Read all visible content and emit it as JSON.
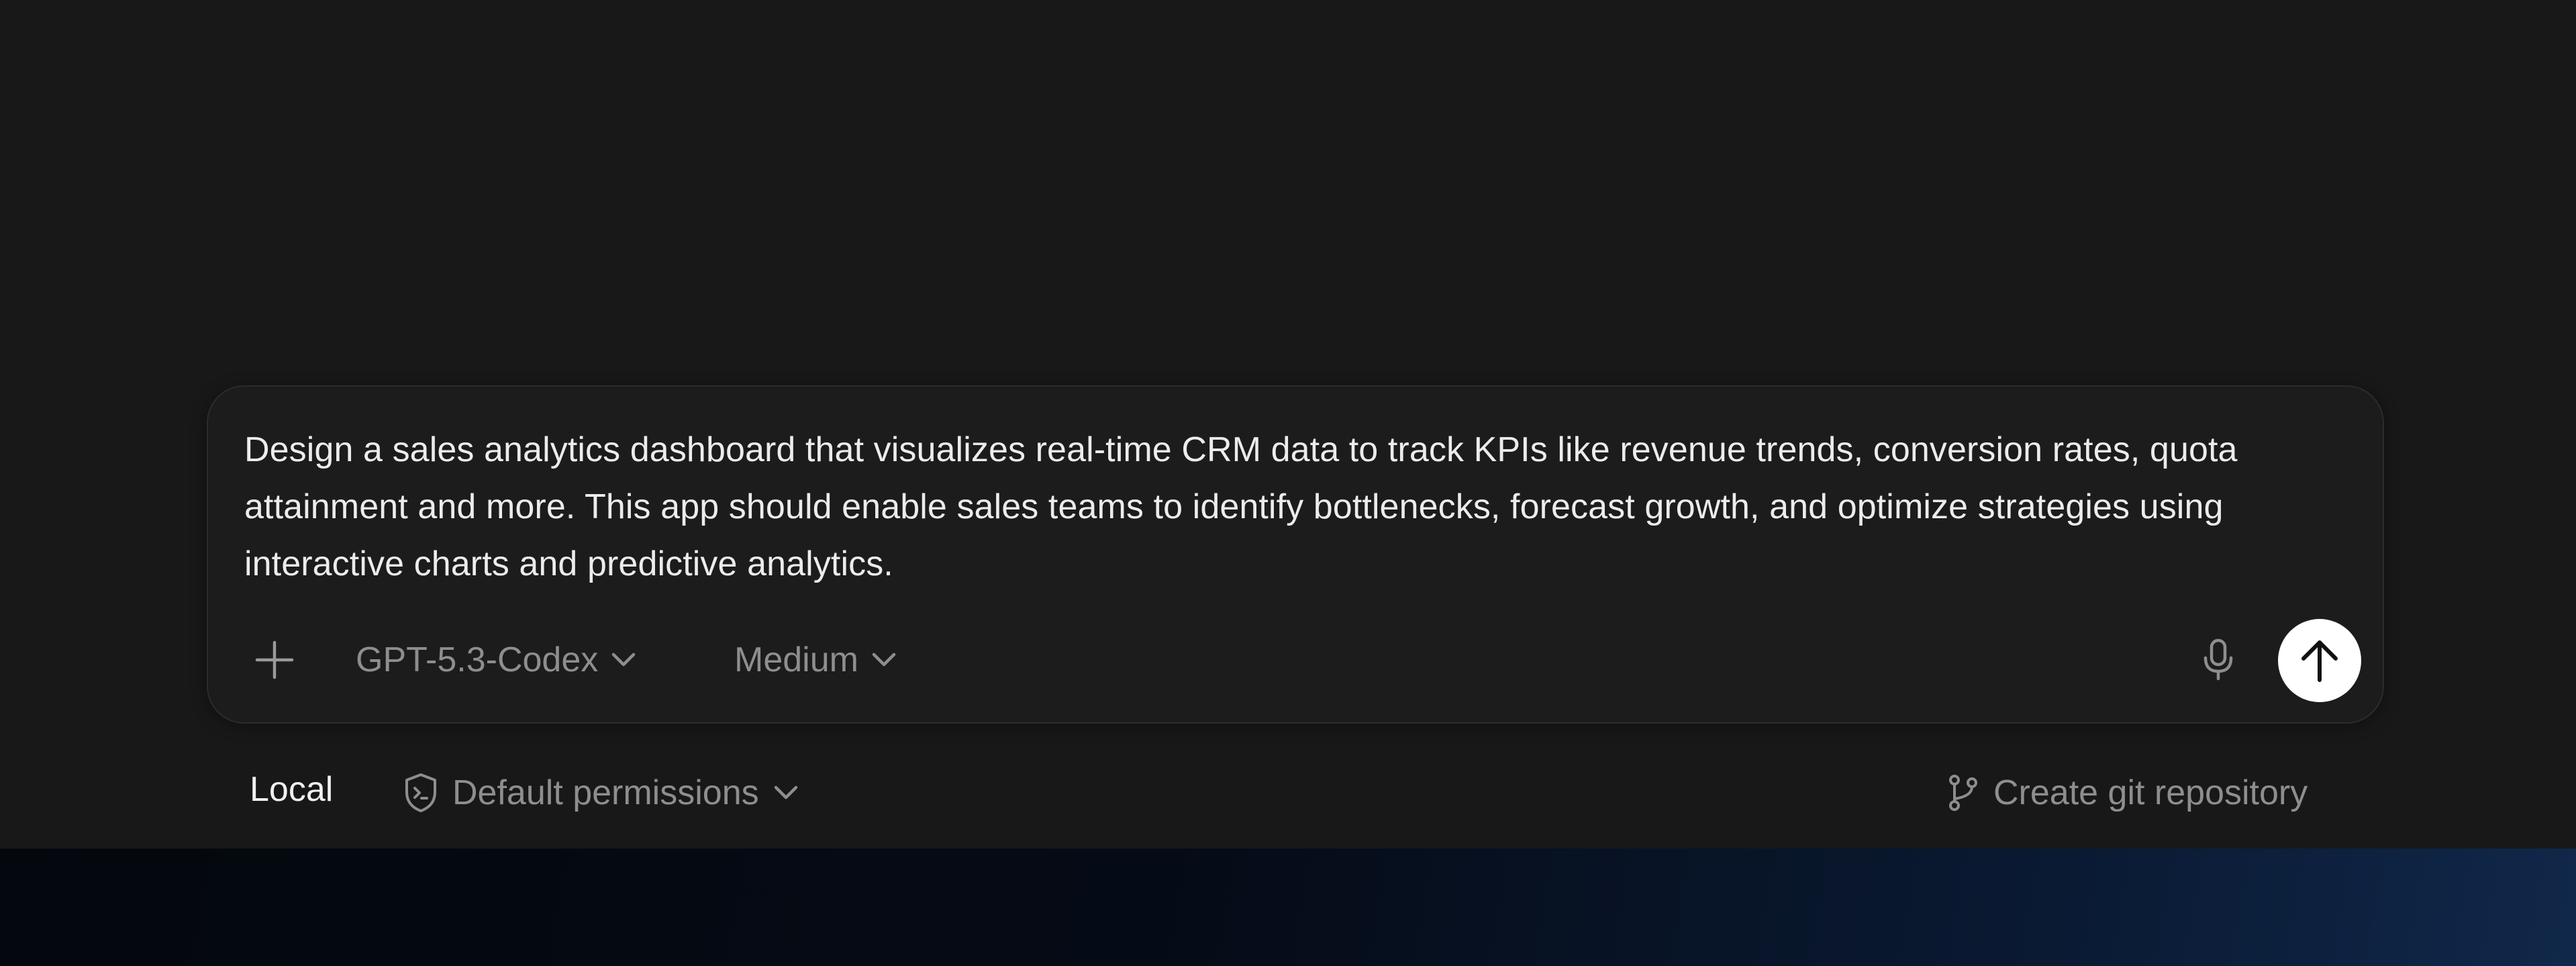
{
  "composer": {
    "prompt_text": "Design a sales analytics dashboard that visualizes real-time CRM data to track KPIs like revenue trends, conversion rates, quota attainment and more. This app should enable sales teams to identify bottlenecks, forecast growth, and optimize strategies using interactive charts and predictive analytics.",
    "model_label": "GPT-5.3-Codex",
    "effort_label": "Medium",
    "icons": {
      "attach": "plus-icon",
      "mic": "microphone-icon",
      "send": "arrow-up-icon"
    }
  },
  "footer": {
    "environment_label": "Local",
    "permissions_label": "Default permissions",
    "git_label": "Create git repository",
    "icons": {
      "permissions": "shield-terminal-icon",
      "git": "git-branch-icon"
    }
  },
  "colors": {
    "background": "#181818",
    "composer_bg": "#1c1c1c",
    "composer_border": "#2c2c2c",
    "text_primary": "#ececec",
    "text_muted": "#8e8e8e",
    "send_button": "#ffffff"
  }
}
